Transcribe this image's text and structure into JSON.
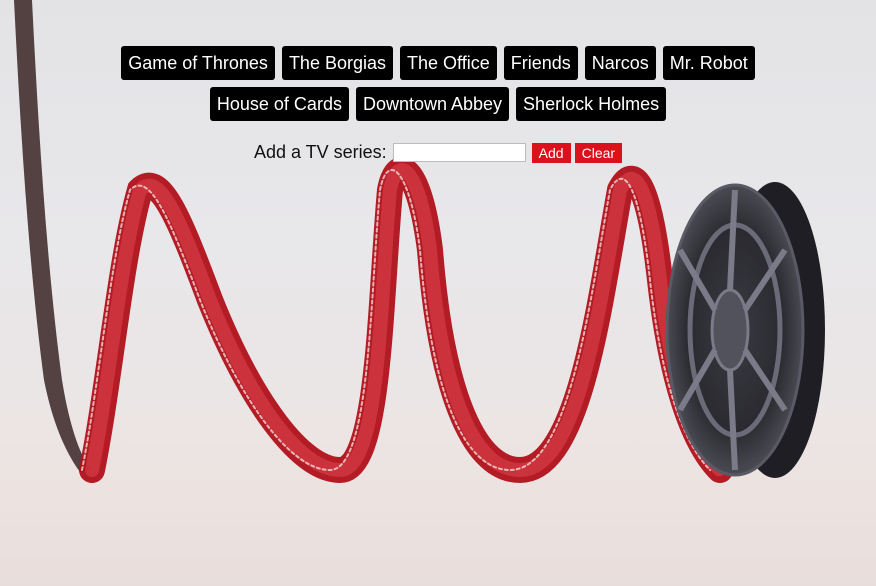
{
  "series": [
    {
      "label": "Game of Thrones"
    },
    {
      "label": "The Borgias"
    },
    {
      "label": "The Office"
    },
    {
      "label": "Friends"
    },
    {
      "label": "Narcos"
    },
    {
      "label": "Mr. Robot"
    },
    {
      "label": "House of Cards"
    },
    {
      "label": "Downtown Abbey"
    },
    {
      "label": "Sherlock Holmes"
    }
  ],
  "add_form": {
    "label": "Add a TV series:",
    "input_value": "",
    "add_label": "Add",
    "clear_label": "Clear"
  },
  "colors": {
    "tag_background": "#000000",
    "tag_text": "#ffffff",
    "button_background": "#d9121b",
    "film_red": "#c0121b"
  }
}
